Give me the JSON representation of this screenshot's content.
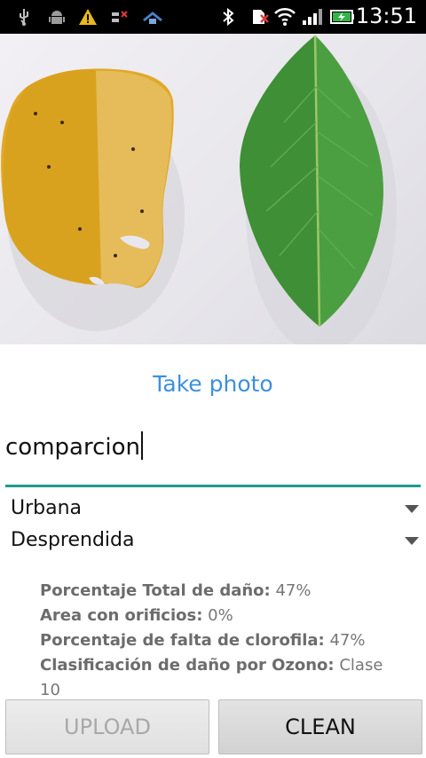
{
  "status_bar": {
    "time": "13:51",
    "icons": [
      "usb-icon",
      "android-debug-icon",
      "warning-icon",
      "signal-off-icon",
      "data-sync-icon",
      "bluetooth-icon",
      "sim-off-icon",
      "wifi-icon",
      "cell-signal-icon",
      "battery-charging-icon"
    ]
  },
  "photo": {
    "description_icon": "leaf-comparison-photo"
  },
  "take_photo_label": "Take photo",
  "name_input": {
    "value": "comparcion"
  },
  "spinners": [
    {
      "selected": "Urbana"
    },
    {
      "selected": "Desprendida"
    }
  ],
  "results": [
    {
      "label": "Porcentaje Total de daño:",
      "value": " 47%"
    },
    {
      "label": "Area con orificios:",
      "value": " 0%"
    },
    {
      "label": "Porcentaje de falta de clorofila:",
      "value": " 47%"
    },
    {
      "label": "Clasificación de daño por Ozono:",
      "value": " Clase 10"
    }
  ],
  "buttons": {
    "upload": "UPLOAD",
    "clean": "CLEAN"
  }
}
